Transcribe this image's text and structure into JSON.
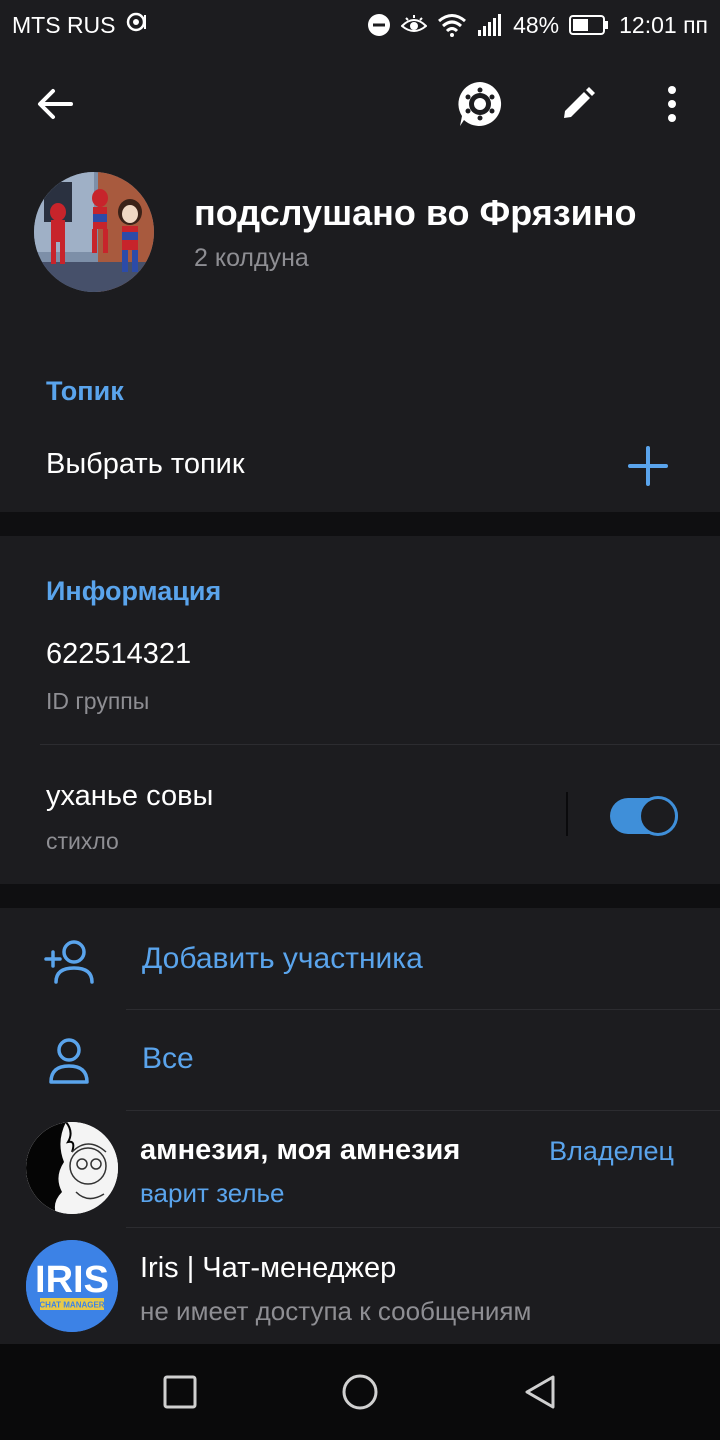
{
  "status_bar": {
    "carrier": "MTS RUS",
    "battery": "48%",
    "time": "12:01 пп"
  },
  "header": {
    "title": "подслушано во Фрязино",
    "subtitle": "2 колдуна"
  },
  "topic_section": {
    "header": "Топик",
    "choose_label": "Выбрать топик"
  },
  "info_section": {
    "header": "Информация",
    "group_id": "622514321",
    "group_id_caption": "ID группы",
    "notification_label": "уханье совы",
    "notification_value": "стихло",
    "notification_enabled": true
  },
  "members_section": {
    "add_member": "Добавить участника",
    "all": "Все",
    "members": [
      {
        "name": "амнезия, моя амнезия",
        "status": "варит зелье",
        "role": "Владелец"
      },
      {
        "name": "Iris | Чат-менеджер",
        "status": "не имеет доступа к сообщениям",
        "role": ""
      }
    ]
  },
  "iris_logo": {
    "text": "IRIS",
    "caption": "CHAT MANAGER"
  },
  "colors": {
    "accent": "#5aa4ec",
    "switch": "#3f8fd9",
    "surface": "#1c1c1f",
    "background": "#0f0f11"
  },
  "icons": [
    "back-arrow-icon",
    "palette-icon",
    "pencil-icon",
    "more-vert-icon",
    "plus-icon",
    "add-person-icon",
    "person-icon",
    "square-icon",
    "circle-icon",
    "triangle-back-icon"
  ]
}
